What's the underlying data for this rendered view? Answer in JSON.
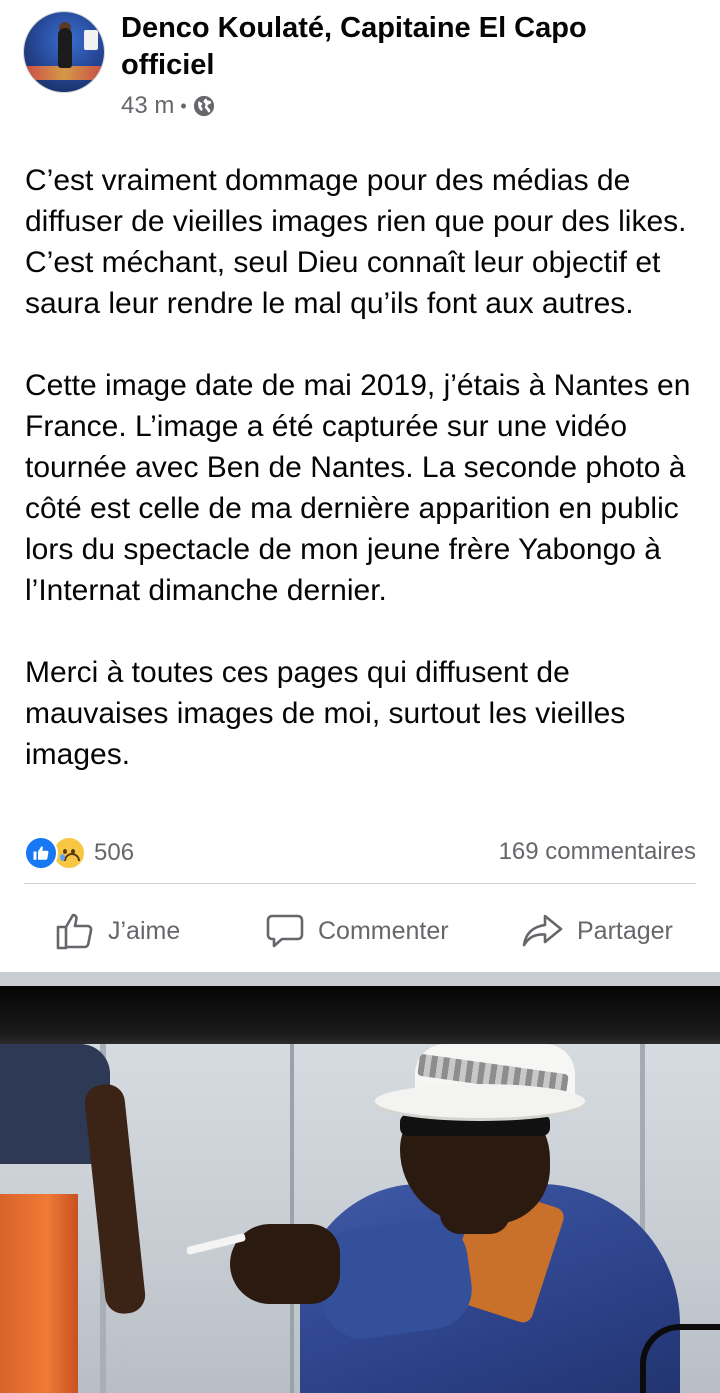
{
  "post": {
    "author": "Denco Koulaté, Capitaine El Capo officiel",
    "time": "43 m",
    "separator_dot": "•",
    "privacy_icon": "globe-icon",
    "paragraphs": [
      "C’est vraiment dommage pour des médias de diffuser de vieilles images rien que pour des likes. C’est méchant, seul Dieu connaît leur objectif et saura leur rendre le mal qu’ils font aux autres.",
      "Cette image date de mai 2019, j’étais à Nantes en France. L’image a été capturée sur une vidéo tournée avec Ben de Nantes. La seconde photo à côté est celle de ma dernière apparition en public lors du spectacle de mon jeune frère Yabongo à l’Internat dimanche dernier.",
      "Merci à toutes ces pages qui diffusent de mauvaises images de moi, surtout les vieilles images."
    ],
    "reactions": {
      "icons": [
        "like-reaction-icon",
        "sad-reaction-icon"
      ],
      "count": "506"
    },
    "comments_count": "169 commentaires"
  },
  "actions": {
    "like": "J’aime",
    "comment": "Commenter",
    "share": "Partager"
  },
  "colors": {
    "text": "#050505",
    "secondary": "#65676b",
    "like_blue": "#1877f2",
    "divider": "#ced0d4",
    "separator": "#c9ccd1"
  }
}
